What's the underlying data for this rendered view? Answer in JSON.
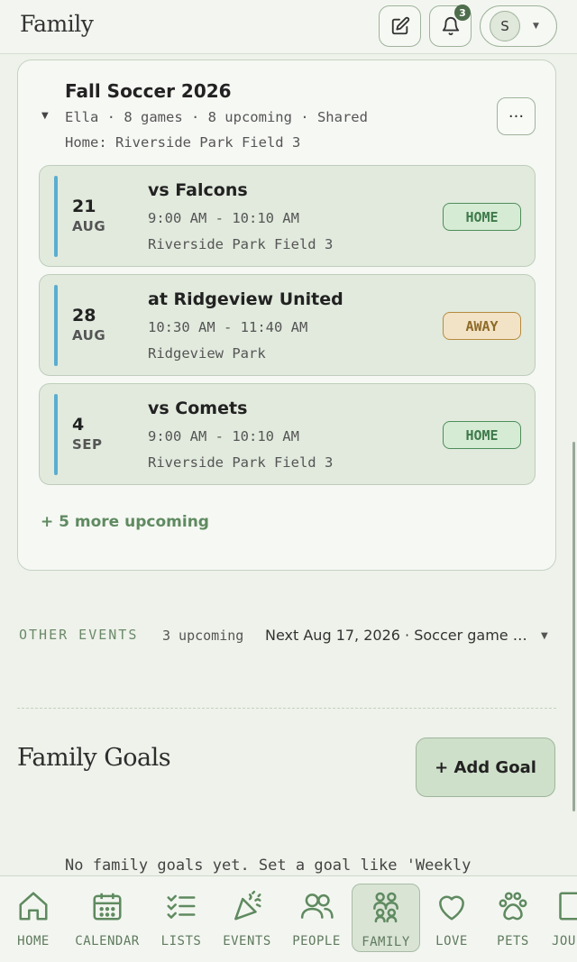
{
  "header": {
    "title": "Family",
    "notification_count": "3",
    "user_initial": "S"
  },
  "season": {
    "title": "Fall Soccer 2026",
    "meta": "Ella · 8 games · 8 upcoming · Shared",
    "home": "Home: Riverside Park Field 3",
    "more_label": "···",
    "games": [
      {
        "day": "21",
        "month": "AUG",
        "opponent": "vs Falcons",
        "time": "9:00 AM - 10:10 AM",
        "location": "Riverside Park Field 3",
        "tag": "HOME"
      },
      {
        "day": "28",
        "month": "AUG",
        "opponent": "at Ridgeview United",
        "time": "10:30 AM - 11:40 AM",
        "location": "Ridgeview Park",
        "tag": "AWAY"
      },
      {
        "day": "4",
        "month": "SEP",
        "opponent": "vs Comets",
        "time": "9:00 AM - 10:10 AM",
        "location": "Riverside Park Field 3",
        "tag": "HOME"
      }
    ],
    "more_upcoming": "+ 5 more upcoming"
  },
  "other_events": {
    "label": "OTHER EVENTS",
    "count": "3 upcoming",
    "next": "Next Aug 17, 2026 · Soccer game v..."
  },
  "goals": {
    "title": "Family Goals",
    "add_label": "+ Add Goal",
    "empty_text": "No family goals yet. Set a goal like 'Weekly"
  },
  "nav": [
    {
      "label": "HOME",
      "icon": "home-icon"
    },
    {
      "label": "CALENDAR",
      "icon": "calendar-icon"
    },
    {
      "label": "LISTS",
      "icon": "list-icon"
    },
    {
      "label": "EVENTS",
      "icon": "party-icon"
    },
    {
      "label": "PEOPLE",
      "icon": "people-icon"
    },
    {
      "label": "FAMILY",
      "icon": "family-icon"
    },
    {
      "label": "LOVE",
      "icon": "heart-icon"
    },
    {
      "label": "PETS",
      "icon": "paw-icon"
    },
    {
      "label": "JOU",
      "icon": "journal-icon"
    }
  ],
  "colors": {
    "accent": "#5f8a60",
    "home_tag": "#3e7a4a",
    "away_tag": "#8e6a28",
    "game_bar": "#5aaed0"
  }
}
